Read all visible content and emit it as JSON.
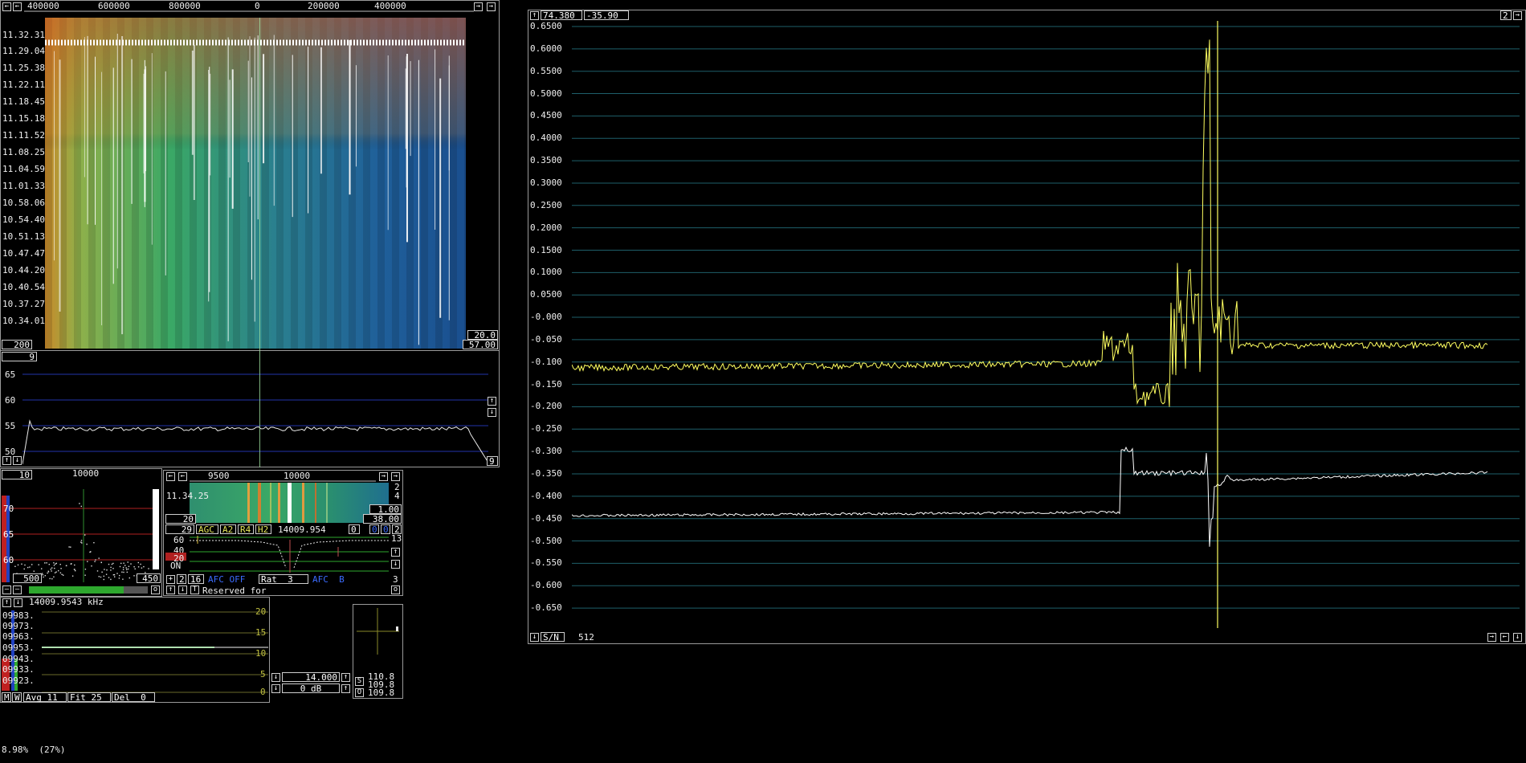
{
  "waterfall": {
    "freq_ticks": [
      "400000",
      "600000",
      "800000",
      "0",
      "200000",
      "400000"
    ],
    "time_labels": [
      "11.32.31",
      "11.29.04",
      "11.25.38",
      "11.22.11",
      "11.18.45",
      "11.15.18",
      "11.11.52",
      "11.08.25",
      "11.04.59",
      "11.01.33",
      "10.58.06",
      "10.54.40",
      "10.51.13",
      "10.47.47",
      "10.44.20",
      "10.40.54",
      "10.37.27",
      "10.34.01"
    ],
    "bottom_left_value": "200",
    "bottom_right_top": "20.0",
    "bottom_right_bottom": "57.00"
  },
  "spectrum": {
    "top_box": "9",
    "y_labels": [
      "65",
      "60",
      "55",
      "50"
    ],
    "corner_value": "9"
  },
  "small_spec": {
    "top_box": "10",
    "freq_tick": "10000",
    "y_labels": [
      "70",
      "65",
      "60"
    ],
    "left_value": "500",
    "right_value": "450"
  },
  "hires": {
    "freq_ticks": [
      "9500",
      "10000"
    ],
    "time_label": "11.34.25",
    "right_digits": [
      "2",
      "4"
    ],
    "gain_value": "1.00",
    "range_value": "38.00",
    "bottom_left": "20",
    "bar_num": "29",
    "agc": "AGC",
    "a2": "A2",
    "r4": "R4",
    "h2": "H2",
    "frequency": "14009.954",
    "num_a": "0",
    "num_b": "0",
    "num_c": "0",
    "num_d": "2",
    "right_num": "13",
    "scale_labels": [
      "60",
      "40",
      "20",
      "ON"
    ],
    "bottom_nums": [
      "2",
      "16"
    ],
    "afc_off": "AFC OFF",
    "rat": "Rat  3",
    "afc_b": "AFC  B",
    "right_bottom": "3",
    "reserved": "Reserved for"
  },
  "freq_panel": {
    "readout": "14009.9543 kHz",
    "rows": [
      "09983.",
      "09973.",
      "09963.",
      "09953.",
      "09943.",
      "09933.",
      "09923."
    ],
    "scale": [
      "20",
      "15",
      "10",
      "5",
      "0"
    ],
    "m": "M",
    "w": "W",
    "avg": "Avg 11",
    "fit": "Fit 25",
    "del": "Del  0"
  },
  "level": {
    "freq": "14.000",
    "db": "0 dB",
    "s": "S",
    "o": "O",
    "values": [
      "110.8",
      "109.8",
      "109.8"
    ]
  },
  "graph": {
    "coord_x": "74.380",
    "coord_y": "-35.90",
    "corner": "2",
    "sn": "S/N",
    "points": "512",
    "y_labels": [
      "0.6500",
      "0.6000",
      "0.5500",
      "0.5000",
      "0.4500",
      "0.4000",
      "0.3500",
      "0.3000",
      "0.2500",
      "0.2000",
      "0.1500",
      "0.1000",
      "0.0500",
      "-0.000",
      "-0.050",
      "-0.100",
      "-0.150",
      "-0.200",
      "-0.250",
      "-0.300",
      "-0.350",
      "-0.400",
      "-0.450",
      "-0.500",
      "-0.550",
      "-0.600",
      "-0.650"
    ]
  },
  "status": "8.98%  (27%)",
  "colors": {
    "accent_blue": "#3b6cff",
    "trace_yellow": "#ffff60",
    "trace_white": "#ffffff",
    "grid": "#1e6e6e"
  }
}
